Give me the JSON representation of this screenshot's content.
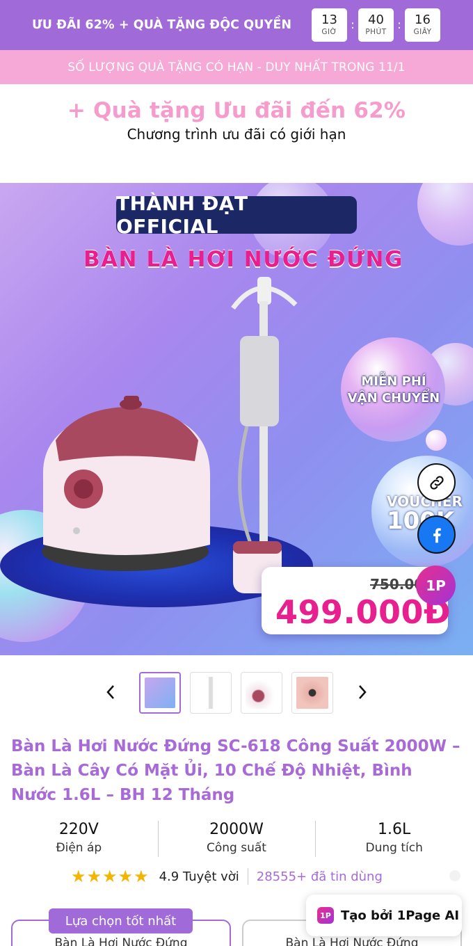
{
  "topbar": {
    "title": "ƯU ĐÃI 62% + QUÀ TẶNG ĐỘC QUYỀN",
    "timer": [
      {
        "value": "13",
        "label": "GIỜ"
      },
      {
        "value": "40",
        "label": "PHÚT"
      },
      {
        "value": "16",
        "label": "GIÂY"
      }
    ],
    "separator": ":"
  },
  "notice": "SỐ LƯỢNG QUÀ TẶNG CÓ HẠN - DUY NHẤT TRONG 11/1",
  "promo": {
    "title": "+ Quà tặng Ưu đãi đến 62%",
    "subtitle": "Chương trình ưu đãi có giới hạn"
  },
  "hero": {
    "brand": "THÀNH ĐẠT OFFICIAL",
    "headline": "BÀN LÀ HƠI NƯỚC ĐỨNG",
    "shipping_line1": "MIỄN PHÍ",
    "shipping_line2": "VẬN CHUYỂN",
    "voucher_line1": "VOUCHER",
    "voucher_line2": "100K",
    "old_price": "750.000",
    "new_price": "499.000Đ",
    "colors": {
      "brand": "#a06ad8",
      "pink": "#e8208f"
    }
  },
  "floating": {
    "link_icon": "link-icon",
    "facebook_icon": "facebook-icon",
    "app_logo": "1P"
  },
  "gallery": {
    "prev_icon": "‹",
    "next_icon": "›",
    "active_index": 0,
    "thumbnail_count": 4
  },
  "product": {
    "title": "Bàn Là Hơi Nước Đứng SC-618 Công Suất 2000W – Bàn Là Cây Có Mặt Ủi, 10 Chế Độ Nhiệt, Bình Nước 1.6L – BH 12 Tháng",
    "specs": [
      {
        "value": "220V",
        "label": "Điện áp"
      },
      {
        "value": "2000W",
        "label": "Công suất"
      },
      {
        "value": "1.6L",
        "label": "Dung tích"
      }
    ],
    "rating": {
      "stars": "★★★★★",
      "score_text": "4.9 Tuyệt vời",
      "count_text": "28555+ đã tin dùng",
      "star_color": "#f4b400"
    }
  },
  "options": {
    "best_tag": "Lựa chọn tốt nhất",
    "items": [
      "Bàn Là Hơi Nước Đứng",
      "Bàn Là Hơi Nước Đứng"
    ]
  },
  "made_by": {
    "logo": "1P",
    "text": "Tạo bởi 1Page AI"
  }
}
